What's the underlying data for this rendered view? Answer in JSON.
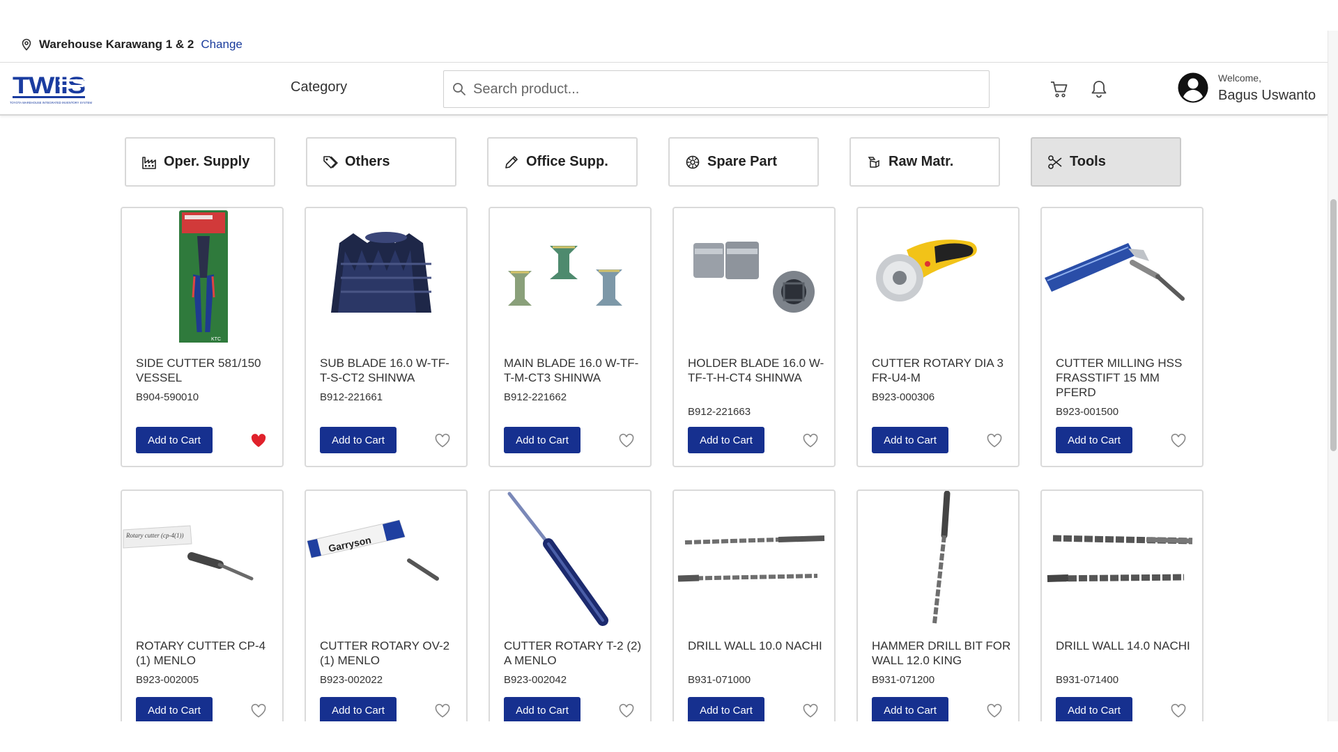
{
  "location": {
    "warehouse": "Warehouse Karawang 1 & 2",
    "change_label": "Change"
  },
  "header": {
    "logo_text": "TWIIS",
    "logo_subtext": "TOYOTA WAREHOUSE INTEGRATED INVENTORY SYSTEM",
    "category_label": "Category",
    "search_placeholder": "Search product...",
    "welcome": "Welcome,",
    "username": "Bagus Uswanto"
  },
  "categories": [
    {
      "label": "Oper. Supply",
      "icon": "factory-icon",
      "active": false
    },
    {
      "label": "Others",
      "icon": "tags-icon",
      "active": false
    },
    {
      "label": "Office Supp.",
      "icon": "pencil-icon",
      "active": false
    },
    {
      "label": "Spare Part",
      "icon": "gear-icon",
      "active": false
    },
    {
      "label": "Raw Matr.",
      "icon": "raw-material-icon",
      "active": false
    },
    {
      "label": "Tools",
      "icon": "scissors-icon",
      "active": true
    }
  ],
  "products": [
    {
      "name": "SIDE CUTTER 581/150 VESSEL",
      "code": "B904-590010",
      "add_label": "Add to Cart",
      "favorite": true
    },
    {
      "name": "SUB BLADE 16.0 W-TF-T-S-CT2 SHINWA",
      "code": "B912-221661",
      "add_label": "Add to Cart",
      "favorite": false
    },
    {
      "name": "MAIN BLADE 16.0 W-TF-T-M-CT3 SHINWA",
      "code": "B912-221662",
      "add_label": "Add to Cart",
      "favorite": false
    },
    {
      "name": "HOLDER BLADE 16.0 W-TF-T-H-CT4 SHINWA",
      "code": "B912-221663",
      "add_label": "Add to Cart",
      "favorite": false
    },
    {
      "name": "CUTTER ROTARY DIA 3 FR-U4-M",
      "code": "B923-000306",
      "add_label": "Add to Cart",
      "favorite": false
    },
    {
      "name": "CUTTER MILLING HSS FRASSTIFT 15 MM PFERD",
      "code": "B923-001500",
      "add_label": "Add to Cart",
      "favorite": false
    },
    {
      "name": "ROTARY CUTTER CP-4 (1) MENLO",
      "code": "B923-002005",
      "add_label": "Add to Cart",
      "favorite": false
    },
    {
      "name": "CUTTER ROTARY OV-2 (1) MENLO",
      "code": "B923-002022",
      "add_label": "Add to Cart",
      "favorite": false
    },
    {
      "name": "CUTTER ROTARY T-2 (2) A MENLO",
      "code": "B923-002042",
      "add_label": "Add to Cart",
      "favorite": false
    },
    {
      "name": "DRILL WALL 10.0 NACHI",
      "code": "B931-071000",
      "add_label": "Add to Cart",
      "favorite": false
    },
    {
      "name": "HAMMER DRILL BIT FOR WALL 12.0 KING",
      "code": "B931-071200",
      "add_label": "Add to Cart",
      "favorite": false
    },
    {
      "name": "DRILL WALL 14.0 NACHI",
      "code": "B931-071400",
      "add_label": "Add to Cart",
      "favorite": false
    }
  ],
  "product_image_labels": {
    "cp4_tube": "Rotary cutter (cp-4(1))",
    "ov2_tube": "Garryson"
  },
  "colors": {
    "primary_button": "#16308f",
    "favorite_active": "#e0212b",
    "logo_blue": "#1a3ca0"
  }
}
